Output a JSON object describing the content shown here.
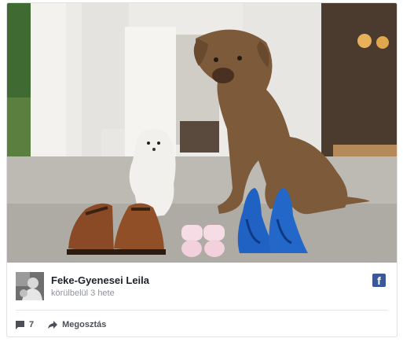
{
  "post": {
    "author": "Feke-Gyenesei Leila",
    "time": "körülbelül 3 hete",
    "network_icon": "facebook-icon",
    "comments_count": "7",
    "share_label": "Megosztás"
  },
  "colors": {
    "facebook_blue": "#3b5998",
    "secondary_text": "#90949c",
    "action_text": "#4b4f56"
  }
}
